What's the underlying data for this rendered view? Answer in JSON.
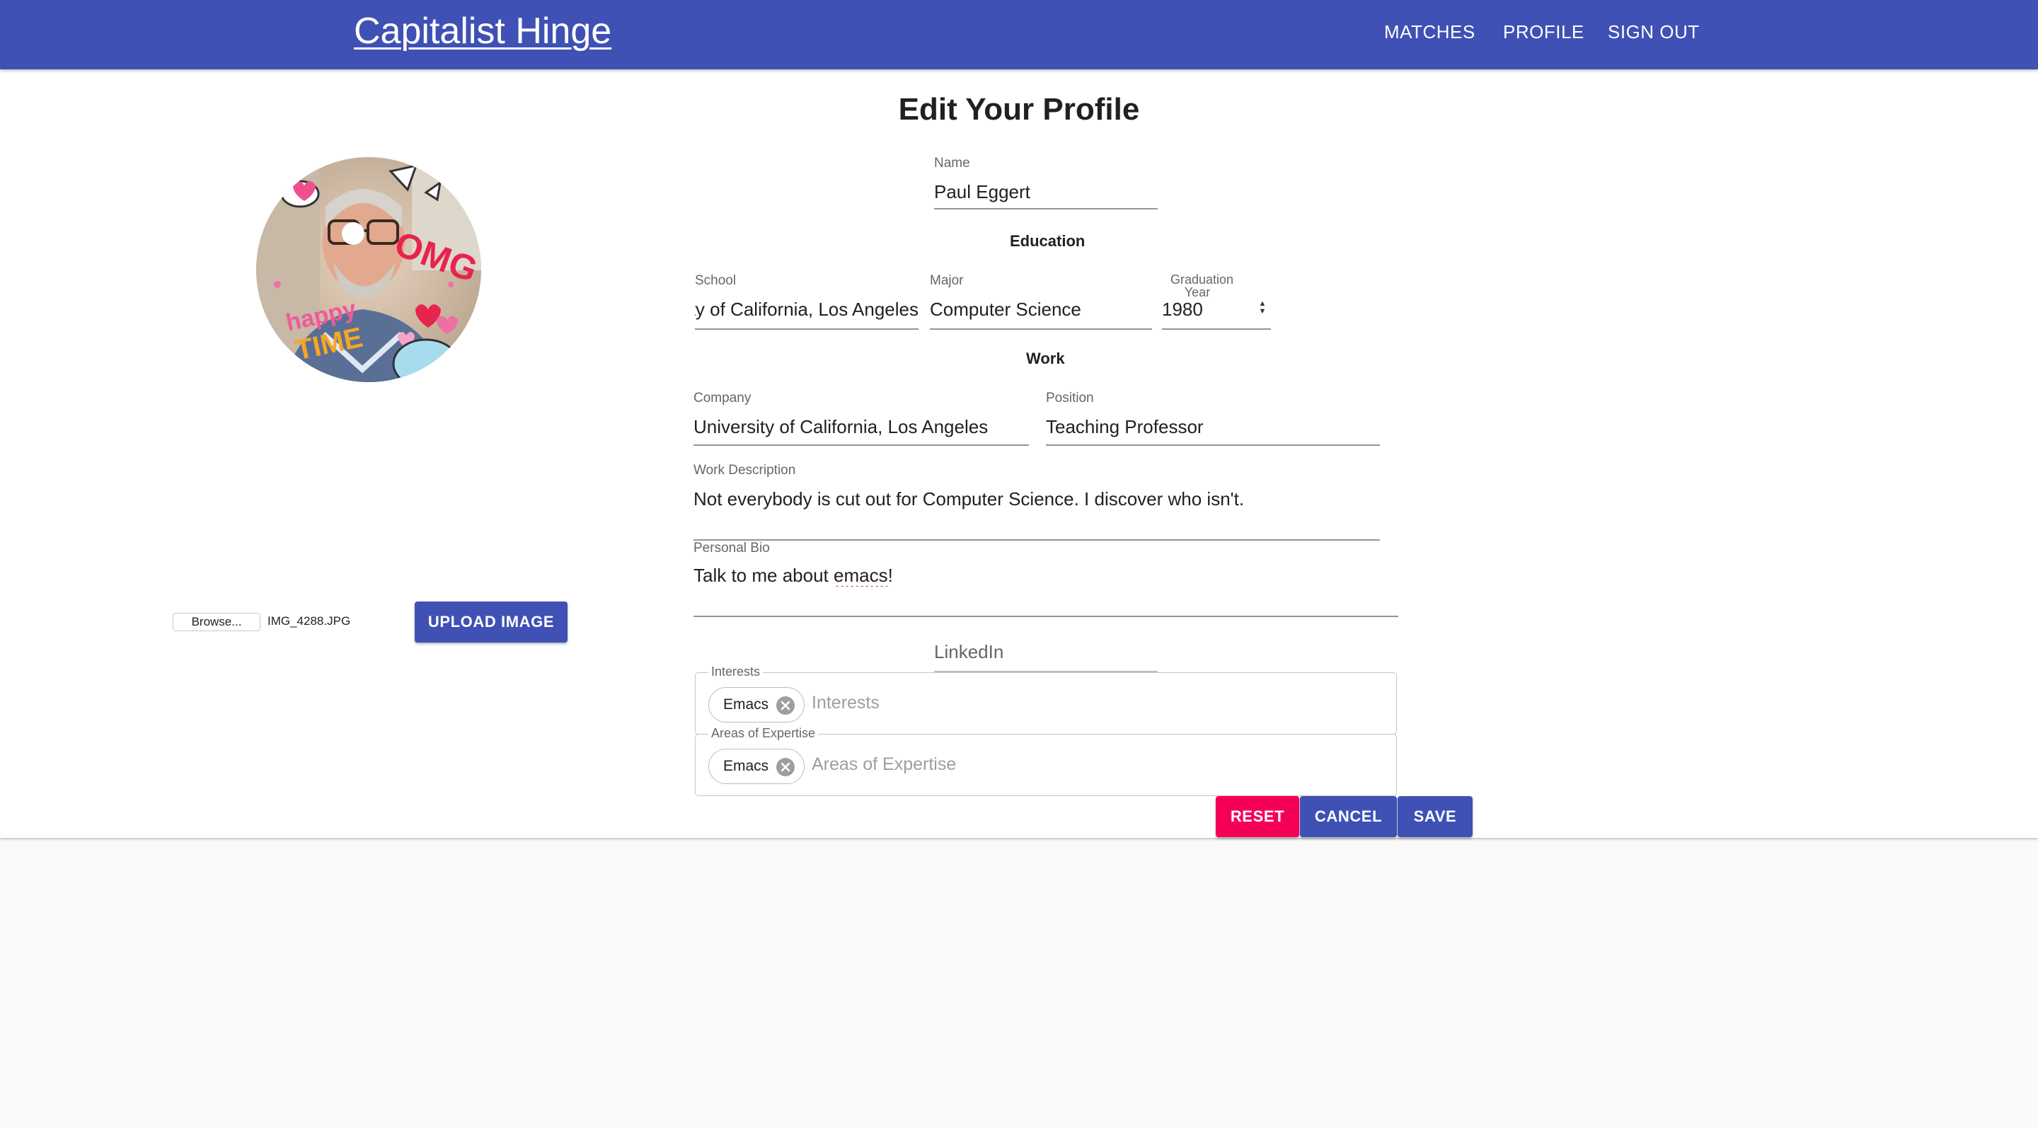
{
  "app": {
    "title": "Capitalist Hinge",
    "nav": {
      "matches": "MATCHES",
      "profile": "PROFILE",
      "sign_out": "SIGN OUT"
    },
    "primary_color": "#3f51b5",
    "secondary_color": "#f50057"
  },
  "page": {
    "title": "Edit Your Profile"
  },
  "profile": {
    "name_label": "Name",
    "name_value": "Paul Eggert",
    "education_title": "Education",
    "school_label": "School",
    "school_value": "University of California, Los Angeles",
    "major_label": "Major",
    "major_value": "Computer Science",
    "grad_year_label": "Graduation Year",
    "grad_year_value": "1980",
    "work_title": "Work",
    "company_label": "Company",
    "company_value": "University of California, Los Angeles",
    "position_label": "Position",
    "position_value": "Teaching Professor",
    "work_desc_label": "Work Description",
    "work_desc_value": "Not everybody is cut out for Computer Science. I discover who isn't.",
    "bio_label": "Personal Bio",
    "bio_before": "Talk to me about ",
    "bio_misspelled": "emacs",
    "bio_after": "!",
    "linkedin_placeholder": "LinkedIn",
    "interests": {
      "label": "Interests",
      "chips": [
        "Emacs"
      ],
      "placeholder": "Interests"
    },
    "expertise": {
      "label": "Areas of Expertise",
      "chips": [
        "Emacs"
      ],
      "placeholder": "Areas of Expertise"
    }
  },
  "image_upload": {
    "browse_label": "Browse...",
    "file_name": "IMG_4288.JPG",
    "upload_label": "UPLOAD IMAGE"
  },
  "actions": {
    "reset": "RESET",
    "cancel": "CANCEL",
    "save": "SAVE"
  }
}
